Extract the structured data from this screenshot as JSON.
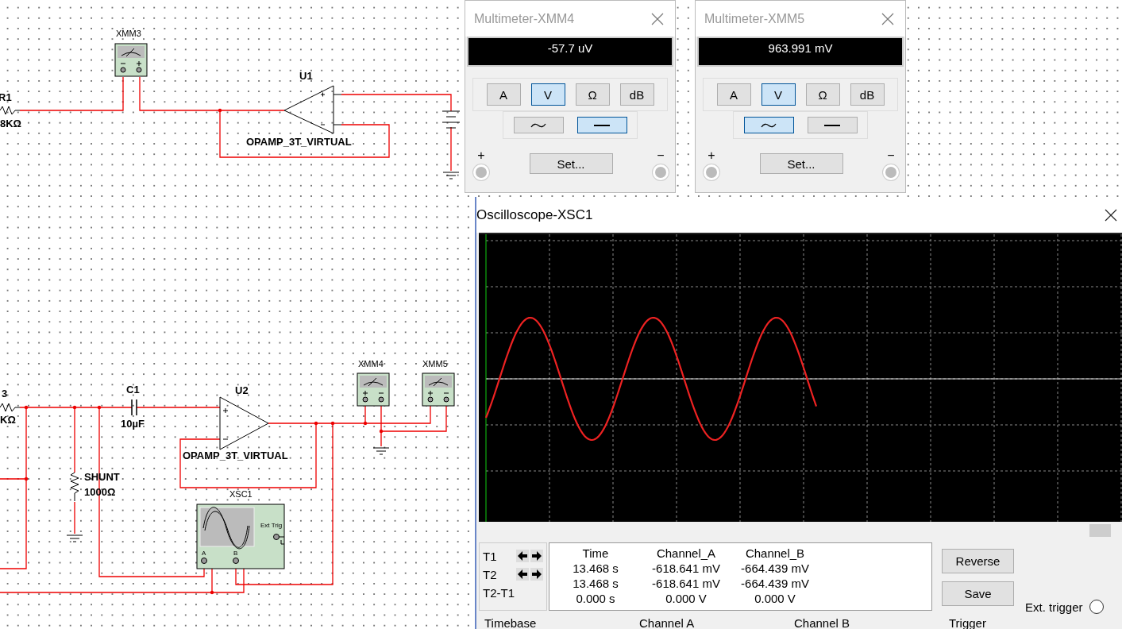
{
  "schematic": {
    "r1_label": "R1",
    "r1_value": "8KΩ",
    "xmm3": "XMM3",
    "u1": "U1",
    "u1_model": "OPAMP_3T_VIRTUAL",
    "r3_label": "3",
    "r3_value": "KΩ",
    "c1": "C1",
    "c1_value": "10µF",
    "u2": "U2",
    "u2_model": "OPAMP_3T_VIRTUAL",
    "shunt": "SHUNT",
    "shunt_value": "1000Ω",
    "xmm4": "XMM4",
    "xmm5": "XMM5",
    "xsc1": "XSC1",
    "ext_trig": "Ext Trig",
    "input_a": "A",
    "input_b": "B"
  },
  "multimeters": [
    {
      "title": "Multimeter-XMM4",
      "reading": "-57.7 uV",
      "modes": [
        {
          "label": "A",
          "selected": false
        },
        {
          "label": "V",
          "selected": true
        },
        {
          "label": "Ω",
          "selected": false
        },
        {
          "label": "dB",
          "selected": false
        }
      ],
      "coupling": [
        {
          "kind": "ac",
          "selected": false
        },
        {
          "kind": "dc",
          "selected": true
        }
      ],
      "set_button": "Set...",
      "plus": "+",
      "minus": "−"
    },
    {
      "title": "Multimeter-XMM5",
      "reading": "963.991 mV",
      "modes": [
        {
          "label": "A",
          "selected": false
        },
        {
          "label": "V",
          "selected": true
        },
        {
          "label": "Ω",
          "selected": false
        },
        {
          "label": "dB",
          "selected": false
        }
      ],
      "coupling": [
        {
          "kind": "ac",
          "selected": true
        },
        {
          "kind": "dc",
          "selected": false
        }
      ],
      "set_button": "Set...",
      "plus": "+",
      "minus": "−"
    }
  ],
  "oscilloscope": {
    "title": "Oscilloscope-XSC1",
    "cursor_labels": [
      "T1",
      "T2",
      "T2-T1"
    ],
    "columns": [
      "Time",
      "Channel_A",
      "Channel_B"
    ],
    "rows": [
      [
        "13.468 s",
        "-618.641 mV",
        "-664.439 mV"
      ],
      [
        "13.468 s",
        "-618.641 mV",
        "-664.439 mV"
      ],
      [
        "0.000 s",
        "0.000 V",
        "0.000 V"
      ]
    ],
    "buttons": [
      "Reverse",
      "Save"
    ],
    "ext_trigger": {
      "label": "Ext. trigger",
      "selected": false
    },
    "sections": [
      "Timebase",
      "Channel A",
      "Channel B",
      "Trigger"
    ]
  }
}
